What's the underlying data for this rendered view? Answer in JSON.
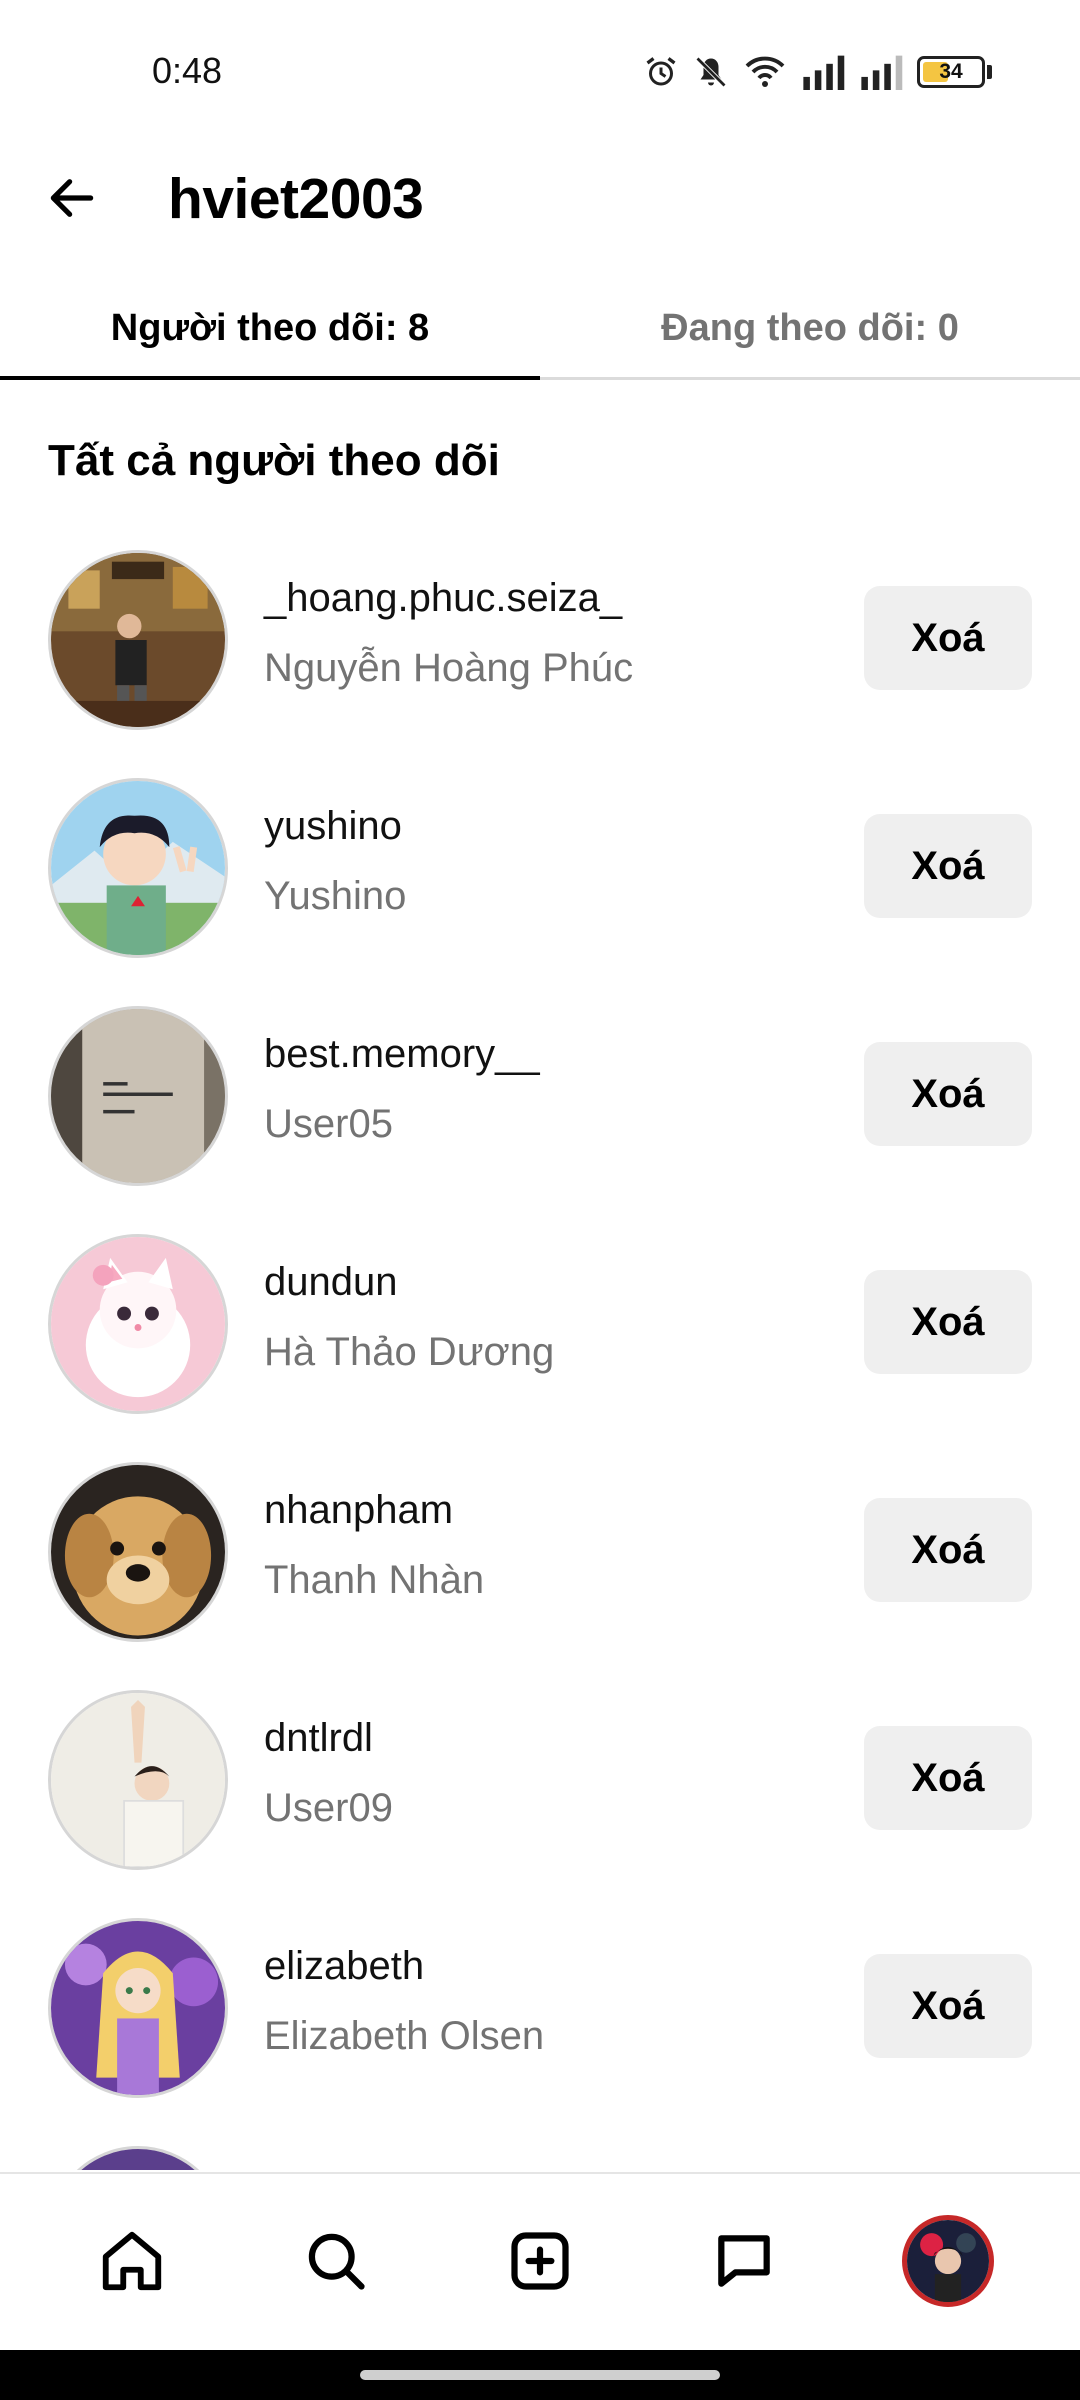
{
  "status_bar": {
    "time": "0:48",
    "battery": "34",
    "icons": [
      "alarm-icon",
      "mute-icon",
      "wifi-icon",
      "signal-icon",
      "signal-icon",
      "battery-icon"
    ]
  },
  "header": {
    "title": "hviet2003",
    "back_icon": "arrow-left-icon"
  },
  "tabs": [
    {
      "label": "Người theo dõi: 8",
      "active": true
    },
    {
      "label": "Đang theo dõi: 0",
      "active": false
    }
  ],
  "section_title": "Tất cả người theo dõi",
  "followers": [
    {
      "username": "_hoang.phuc.seiza_",
      "name": "Nguyễn Hoàng Phúc",
      "button": "Xoá"
    },
    {
      "username": "yushino",
      "name": "Yushino",
      "button": "Xoá"
    },
    {
      "username": "best.memory__",
      "name": "User05",
      "button": "Xoá"
    },
    {
      "username": "dundun",
      "name": "Hà Thảo Dương",
      "button": "Xoá"
    },
    {
      "username": "nhanpham",
      "name": "Thanh Nhàn",
      "button": "Xoá"
    },
    {
      "username": "dntlrdl",
      "name": "User09",
      "button": "Xoá"
    },
    {
      "username": "elizabeth",
      "name": "Elizabeth Olsen",
      "button": "Xoá"
    }
  ],
  "bottom_nav": [
    "home-icon",
    "search-icon",
    "create-post-icon",
    "messages-icon",
    "profile-avatar"
  ],
  "colors": {
    "muted_text": "#737373",
    "button_bg": "#efefef",
    "profile_ring": "#c62828"
  }
}
